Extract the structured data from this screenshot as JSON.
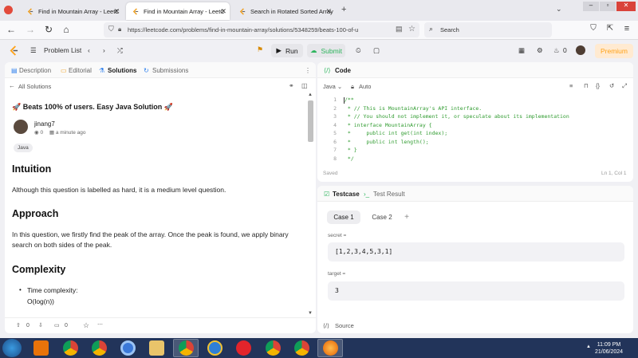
{
  "browser": {
    "tabs": [
      {
        "title": "Find in Mountain Array - LeetC",
        "active": false
      },
      {
        "title": "Find in Mountain Array - LeetC",
        "active": true
      },
      {
        "title": "Search in Rotated Sorted Array",
        "active": false
      }
    ],
    "url": "https://leetcode.com/problems/find-in-mountain-array/solutions/5348259/beats-100-of-u",
    "search_placeholder": "Search"
  },
  "header": {
    "problem_list": "Problem List",
    "run": "Run",
    "submit": "Submit",
    "streak": "0",
    "premium": "Premium"
  },
  "left_tabs": [
    "Description",
    "Editorial",
    "Solutions",
    "Submissions"
  ],
  "back_link": "All Solutions",
  "solution": {
    "title": "🚀 Beats 100% of users. Easy Java Solution 🚀",
    "author": "jinang7",
    "views": "0",
    "time": "a minute ago",
    "tag": "Java",
    "sections": [
      {
        "heading": "Intuition",
        "body": "Although this question is labelled as hard, it is a medium level question."
      },
      {
        "heading": "Approach",
        "body": "In this question, we firstly find the peak of the array. Once the peak is found, we apply binary search on both sides of the peak."
      },
      {
        "heading": "Complexity",
        "body": ""
      }
    ],
    "complexity_item": "Time complexity:",
    "complexity_value": "O(log(n))"
  },
  "left_footer": {
    "upvotes": "0",
    "comments": "0"
  },
  "code": {
    "tab_label": "Code",
    "language": "Java",
    "mode": "Auto",
    "lines": [
      "/**",
      " * // This is MountainArray's API interface.",
      " * // You should not implement it, or speculate about its implementation",
      " * interface MountainArray {",
      " *     public int get(int index);",
      " *     public int length();",
      " * }",
      " */"
    ],
    "line_numbers": [
      "1",
      "2",
      "3",
      "4",
      "5",
      "6",
      "7",
      "8"
    ],
    "status": "Saved",
    "cursor": "Ln 1, Col 1"
  },
  "testcase": {
    "tab_label": "Testcase",
    "result_label": "Test Result",
    "cases": [
      "Case 1",
      "Case 2"
    ],
    "vars": [
      {
        "name": "secret =",
        "value": "[1,2,3,4,5,3,1]"
      },
      {
        "name": "target =",
        "value": "3"
      }
    ],
    "source_label": "Source"
  },
  "taskbar": {
    "time": "11:09 PM",
    "date": "21/06/2024"
  },
  "colors": {
    "accent_orange": "#ffa116",
    "green": "#2db55d",
    "code_comment": "#2f9b2f",
    "taskbar": "#22345a"
  }
}
